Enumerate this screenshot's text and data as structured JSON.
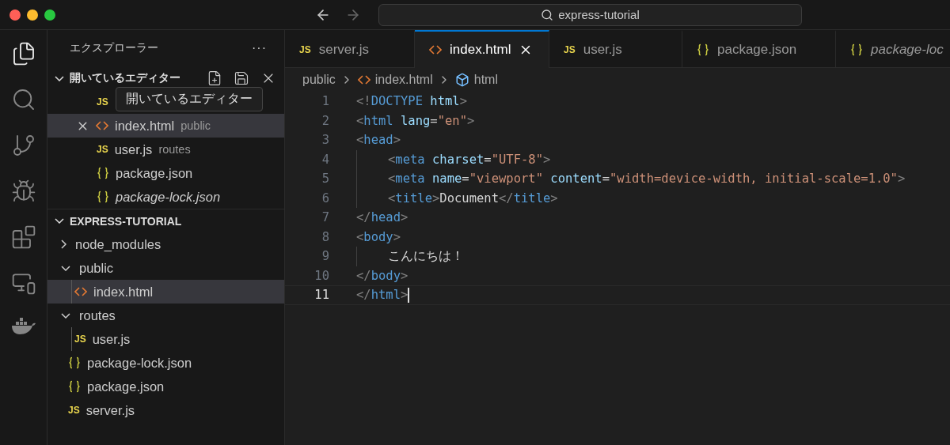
{
  "title_bar": {
    "search": "express-tutorial"
  },
  "activity_bar": [
    {
      "selected": true
    },
    {
      "selected": false
    },
    {
      "selected": false
    },
    {
      "selected": false
    },
    {
      "selected": false
    },
    {
      "selected": false
    },
    {
      "selected": false
    }
  ],
  "sidebar": {
    "title": "エクスプローラー",
    "more": "···",
    "open_editors": {
      "title": "開いているエディター",
      "expanded": true,
      "tooltip": "開いているエディター",
      "items": [
        {
          "kind": "js",
          "badge": "JS",
          "selected": false
        },
        {
          "kind": "html",
          "name": "index.html",
          "description": "public",
          "selected": true,
          "italic": false
        },
        {
          "kind": "js",
          "badge": "JS",
          "name": "user.js",
          "description": "routes",
          "selected": false,
          "italic": false
        },
        {
          "kind": "json",
          "name": "package.json",
          "selected": false,
          "italic": false
        },
        {
          "kind": "json",
          "name": "package-lock.json",
          "selected": false,
          "italic": true
        }
      ]
    },
    "project": {
      "title": "EXPRESS-TUTORIAL",
      "expanded": true,
      "children": [
        {
          "kind": "folder",
          "name": "node_modules",
          "expanded": false,
          "selected": false
        },
        {
          "kind": "folder",
          "name": "public",
          "expanded": true,
          "selected": false,
          "children": [
            {
              "kind": "html",
              "name": "index.html",
              "selected": true
            }
          ]
        },
        {
          "kind": "folder",
          "name": "routes",
          "expanded": true,
          "selected": false,
          "children": [
            {
              "kind": "js",
              "badge": "JS",
              "name": "user.js",
              "selected": false
            }
          ]
        },
        {
          "kind": "json",
          "name": "package-lock.json",
          "selected": false
        },
        {
          "kind": "json",
          "name": "package.json",
          "selected": false
        },
        {
          "kind": "js",
          "badge": "JS",
          "name": "server.js",
          "selected": false
        }
      ]
    }
  },
  "tabs": [
    {
      "kind": "js",
      "badge": "JS",
      "label": "server.js",
      "selected": false,
      "italic": false
    },
    {
      "kind": "html",
      "label": "index.html",
      "selected": true,
      "italic": false
    },
    {
      "kind": "js",
      "badge": "JS",
      "label": "user.js",
      "selected": false,
      "italic": false
    },
    {
      "kind": "json",
      "label": "package.json",
      "selected": false,
      "italic": false
    },
    {
      "kind": "json",
      "label": "package-loc",
      "selected": false,
      "italic": true
    }
  ],
  "breadcrumb": [
    {
      "kind": "folder",
      "label": "public"
    },
    {
      "kind": "html",
      "label": "index.html"
    },
    {
      "kind": "symbol",
      "label": "html"
    }
  ],
  "code": [
    {
      "number": "1",
      "indented": false,
      "current": false,
      "tokens": [
        {
          "kind": "punct",
          "text": "<!"
        },
        {
          "kind": "tag",
          "text": "DOCTYPE"
        },
        {
          "kind": "attr",
          "text": " html"
        },
        {
          "kind": "punct",
          "text": ">"
        }
      ]
    },
    {
      "number": "2",
      "indented": false,
      "current": false,
      "tokens": [
        {
          "kind": "punct",
          "text": "<"
        },
        {
          "kind": "tag",
          "text": "html"
        },
        {
          "kind": "attr",
          "text": " lang"
        },
        {
          "kind": "text",
          "text": "="
        },
        {
          "kind": "str",
          "text": "\"en\""
        },
        {
          "kind": "punct",
          "text": ">"
        }
      ]
    },
    {
      "number": "3",
      "indented": false,
      "current": false,
      "tokens": [
        {
          "kind": "punct",
          "text": "<"
        },
        {
          "kind": "tag",
          "text": "head"
        },
        {
          "kind": "punct",
          "text": ">"
        }
      ]
    },
    {
      "number": "4",
      "indented": true,
      "current": false,
      "tokens": [
        {
          "kind": "punct",
          "text": "<"
        },
        {
          "kind": "tag",
          "text": "meta"
        },
        {
          "kind": "attr",
          "text": " charset"
        },
        {
          "kind": "text",
          "text": "="
        },
        {
          "kind": "str",
          "text": "\"UTF-8\""
        },
        {
          "kind": "punct",
          "text": ">"
        }
      ]
    },
    {
      "number": "5",
      "indented": true,
      "current": false,
      "tokens": [
        {
          "kind": "punct",
          "text": "<"
        },
        {
          "kind": "tag",
          "text": "meta"
        },
        {
          "kind": "attr",
          "text": " name"
        },
        {
          "kind": "text",
          "text": "="
        },
        {
          "kind": "str",
          "text": "\"viewport\""
        },
        {
          "kind": "attr",
          "text": " content"
        },
        {
          "kind": "text",
          "text": "="
        },
        {
          "kind": "str",
          "text": "\"width=device-width, initial-scale=1.0\""
        },
        {
          "kind": "punct",
          "text": ">"
        }
      ]
    },
    {
      "number": "6",
      "indented": true,
      "current": false,
      "tokens": [
        {
          "kind": "punct",
          "text": "<"
        },
        {
          "kind": "tag",
          "text": "title"
        },
        {
          "kind": "punct",
          "text": ">"
        },
        {
          "kind": "text",
          "text": "Document"
        },
        {
          "kind": "punct",
          "text": "</"
        },
        {
          "kind": "tag",
          "text": "title"
        },
        {
          "kind": "punct",
          "text": ">"
        }
      ]
    },
    {
      "number": "7",
      "indented": false,
      "current": false,
      "tokens": [
        {
          "kind": "punct",
          "text": "</"
        },
        {
          "kind": "tag",
          "text": "head"
        },
        {
          "kind": "punct",
          "text": ">"
        }
      ]
    },
    {
      "number": "8",
      "indented": false,
      "current": false,
      "tokens": [
        {
          "kind": "punct",
          "text": "<"
        },
        {
          "kind": "tag",
          "text": "body"
        },
        {
          "kind": "punct",
          "text": ">"
        }
      ]
    },
    {
      "number": "9",
      "indented": true,
      "current": false,
      "tokens": [
        {
          "kind": "text",
          "text": "こんにちは！"
        }
      ]
    },
    {
      "number": "10",
      "indented": false,
      "current": false,
      "tokens": [
        {
          "kind": "punct",
          "text": "</"
        },
        {
          "kind": "tag",
          "text": "body"
        },
        {
          "kind": "punct",
          "text": ">"
        }
      ]
    },
    {
      "number": "11",
      "indented": false,
      "current": true,
      "tokens": [
        {
          "kind": "punct",
          "text": "</"
        },
        {
          "kind": "tag",
          "text": "html"
        },
        {
          "kind": "punct",
          "text": ">"
        }
      ]
    }
  ]
}
